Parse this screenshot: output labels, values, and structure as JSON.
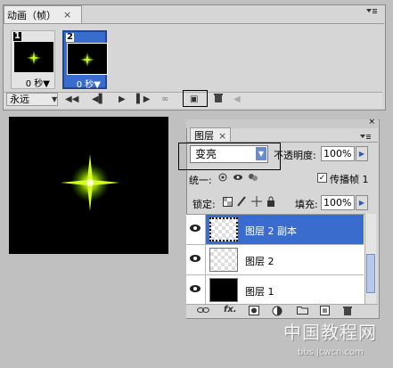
{
  "animation_panel": {
    "tab_title": "动画（帧）",
    "close_symbol": "×",
    "menu_icon": "panel-menu-icon",
    "frames": [
      {
        "number": "1",
        "duration": "0 秒▼",
        "selected": false
      },
      {
        "number": "2",
        "duration": "0 秒▼",
        "selected": true
      }
    ],
    "loop_option": "永远",
    "loop_arrow": "▼",
    "toolbar_glyphs": {
      "first": "◀◀",
      "prev": "◀▌",
      "play": "▶",
      "next": "▌▶",
      "tween": "∞",
      "duplicate": "▣",
      "delete": "🗑",
      "disabled": "◀"
    }
  },
  "layers_panel": {
    "tab_title": "图层",
    "close_symbol": "×",
    "blend_mode": "变亮",
    "opacity_label": "不透明度:",
    "opacity_value": "100%",
    "unify_label": "统一:",
    "propagate_check": "✓",
    "propagate_label": "传播帧 1",
    "lock_label": "锁定:",
    "fill_label": "填充:",
    "fill_value": "100%",
    "arrow": "▶",
    "layers": [
      {
        "name": "图层 2 副本",
        "selected": true
      },
      {
        "name": "图层 2",
        "selected": false
      },
      {
        "name": "图层 1",
        "selected": false
      }
    ],
    "bottom_glyphs": {
      "fx": "fx."
    }
  },
  "watermark": {
    "text": "中国教程网",
    "url": "bbs.jcwcn.com"
  },
  "colors": {
    "selection_blue": "#3a6ccd",
    "star_yellow": "#e8f000",
    "star_green": "#6cff00",
    "background_gray": "#c0c0c0"
  }
}
